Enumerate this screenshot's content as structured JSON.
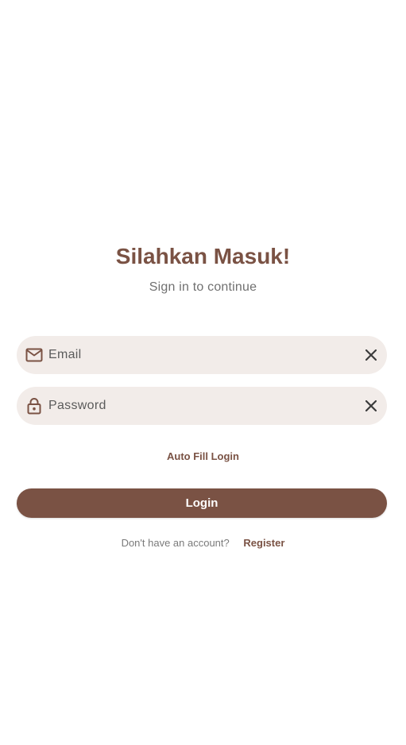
{
  "header": {
    "title": "Silahkan Masuk!",
    "subtitle": "Sign in to continue"
  },
  "form": {
    "email": {
      "placeholder": "Email",
      "value": "",
      "lead_icon": "mail-icon",
      "trail_icon": "clear-icon"
    },
    "password": {
      "placeholder": "Password",
      "value": "",
      "lead_icon": "lock-icon",
      "trail_icon": "clear-icon"
    },
    "autofill_label": "Auto Fill Login",
    "login_label": "Login"
  },
  "footer": {
    "prompt": "Don't have an account?",
    "register_label": "Register"
  },
  "colors": {
    "accent": "#7a5244",
    "field_background": "#f2ece9",
    "muted_text": "#707070"
  }
}
